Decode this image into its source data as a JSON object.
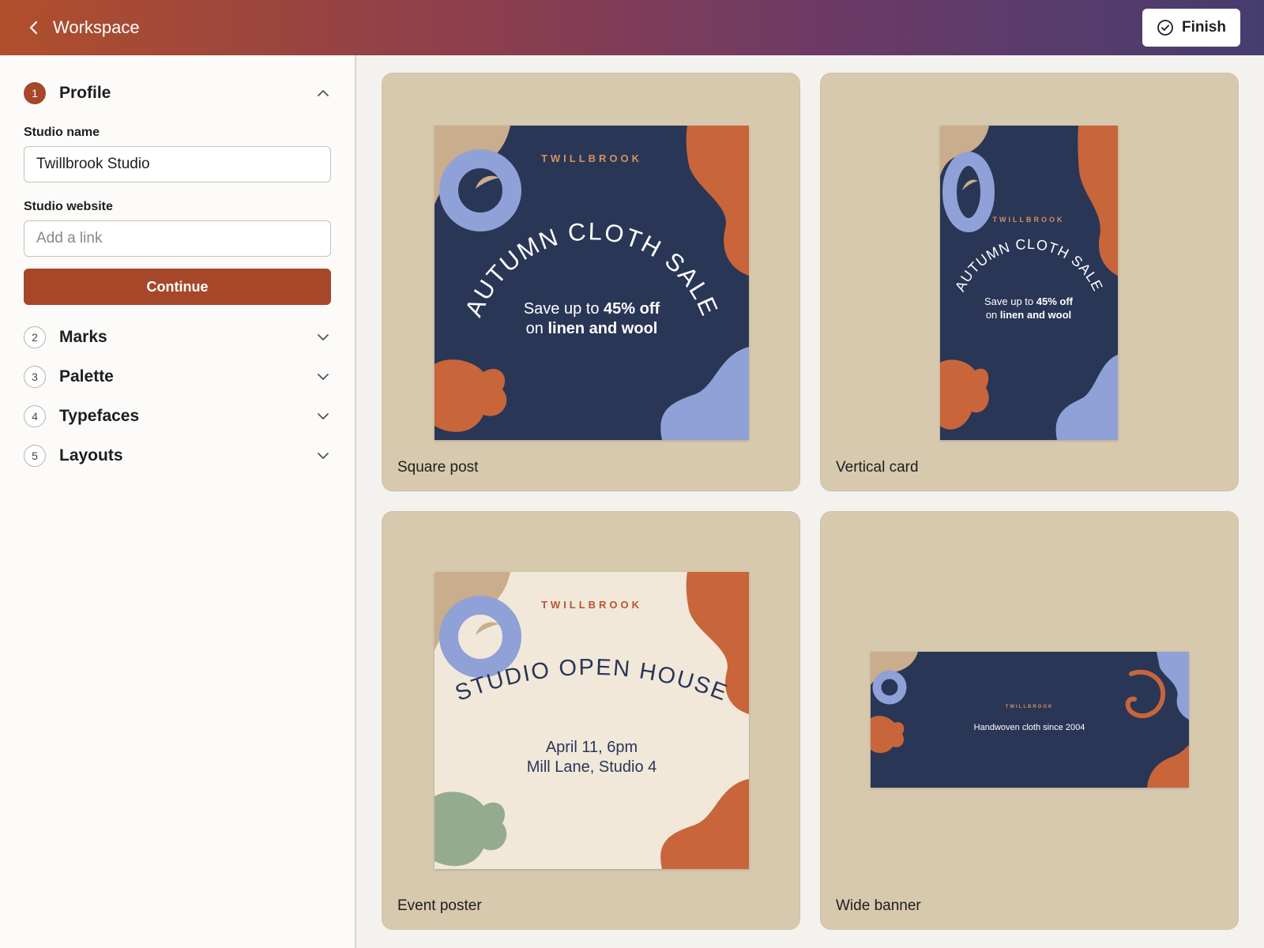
{
  "header": {
    "back_icon": "chevron-left-icon",
    "title": "Workspace",
    "finish_label": "Finish",
    "finish_icon": "check-circle-icon"
  },
  "sidebar": {
    "steps": [
      {
        "number": "1",
        "label": "Profile",
        "expanded": true
      },
      {
        "number": "2",
        "label": "Marks",
        "expanded": false
      },
      {
        "number": "3",
        "label": "Palette",
        "expanded": false
      },
      {
        "number": "4",
        "label": "Typefaces",
        "expanded": false
      },
      {
        "number": "5",
        "label": "Layouts",
        "expanded": false
      }
    ],
    "profile": {
      "studio_name_label": "Studio name",
      "studio_name_value": "Twillbrook Studio",
      "studio_website_label": "Studio website",
      "studio_website_placeholder": "Add a link",
      "continue_label": "Continue"
    }
  },
  "cards": [
    {
      "label": "Square post",
      "brand": "TWILLBROOK",
      "headline": "AUTUMN CLOTH SALE",
      "line1_pre": "Save up to ",
      "line1_bold": "45% off",
      "line2_pre": "on ",
      "line2_bold": "linen and wool"
    },
    {
      "label": "Vertical card",
      "brand": "TWILLBROOK",
      "headline": "AUTUMN CLOTH SALE",
      "line1_pre": "Save up to ",
      "line1_bold": "45% off",
      "line2_pre": "on ",
      "line2_bold": "linen and wool"
    },
    {
      "label": "Event poster",
      "brand": "TWILLBROOK",
      "headline": "STUDIO OPEN HOUSE",
      "line1": "April 11, 6pm",
      "line2": "Mill Lane, Studio 4"
    },
    {
      "label": "Wide banner",
      "brand": "TWILLBROOK",
      "tagline": "Handwoven cloth since 2004"
    }
  ],
  "colors": {
    "accent": "#a6472a",
    "navy": "#2a3656",
    "orange": "#c8653a",
    "periwinkle": "#8fa1d6",
    "tan": "#c9ad8c",
    "cream": "#f1e8da",
    "sage": "#95ab8e",
    "card_bg": "#d6c9ae"
  }
}
